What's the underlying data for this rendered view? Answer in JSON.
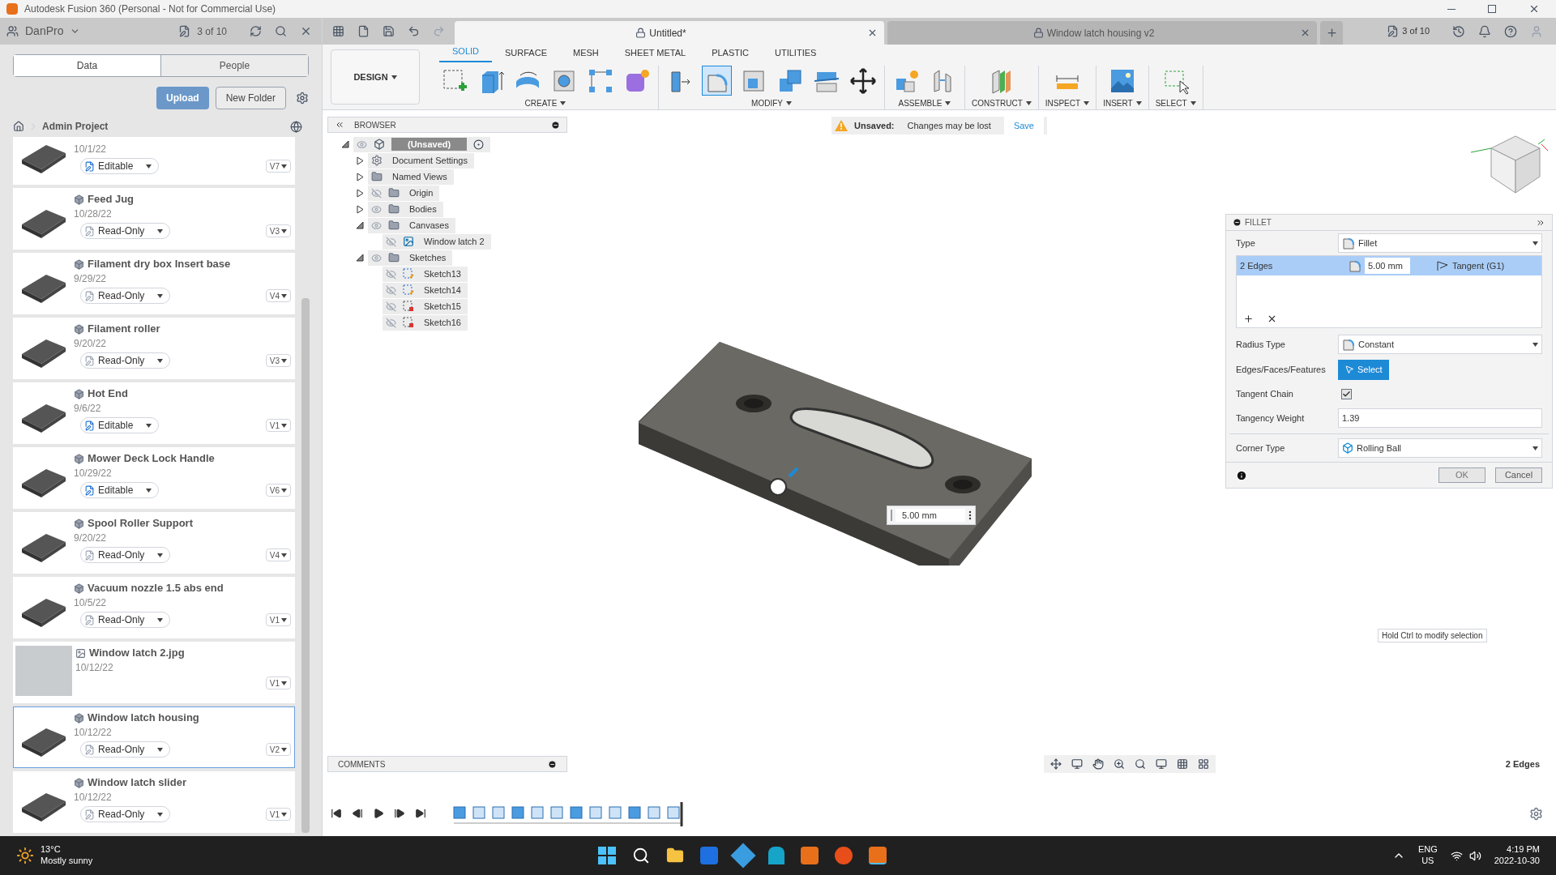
{
  "window": {
    "title": "Autodesk Fusion 360 (Personal - Not for Commercial Use)"
  },
  "data_panel": {
    "team": "DanPro",
    "version_count": "3 of 10",
    "tabs": [
      {
        "label": "Data",
        "selected": true
      },
      {
        "label": "People",
        "selected": false
      }
    ],
    "upload": "Upload",
    "new_folder": "New Folder",
    "breadcrumb": "Admin Project",
    "files": [
      {
        "kind": "design",
        "date": "10/1/22",
        "access": {
          "kind": "editable",
          "label": "Editable"
        },
        "version": "V7",
        "selected": false
      },
      {
        "kind": "design",
        "name": "Feed Jug",
        "date": "10/28/22",
        "access": {
          "kind": "read_only",
          "label": "Read-Only"
        },
        "version": "V3",
        "selected": false
      },
      {
        "kind": "design",
        "name": "Filament dry box Insert base",
        "date": "9/29/22",
        "access": {
          "kind": "read_only",
          "label": "Read-Only"
        },
        "version": "V4",
        "selected": false
      },
      {
        "kind": "design",
        "name": "Filament roller",
        "date": "9/20/22",
        "access": {
          "kind": "read_only",
          "label": "Read-Only"
        },
        "version": "V3",
        "selected": false
      },
      {
        "kind": "design",
        "name": "Hot End",
        "date": "9/6/22",
        "access": {
          "kind": "editable",
          "label": "Editable"
        },
        "version": "V1",
        "selected": false
      },
      {
        "kind": "design",
        "name": "Mower Deck Lock Handle",
        "date": "10/29/22",
        "access": {
          "kind": "editable",
          "label": "Editable"
        },
        "version": "V6",
        "selected": false
      },
      {
        "kind": "design",
        "name": "Spool Roller Support",
        "date": "9/20/22",
        "access": {
          "kind": "read_only",
          "label": "Read-Only"
        },
        "version": "V4",
        "selected": false
      },
      {
        "kind": "design",
        "name": "Vacuum nozzle 1.5 abs end",
        "date": "10/5/22",
        "access": {
          "kind": "read_only",
          "label": "Read-Only"
        },
        "version": "V1",
        "selected": false
      },
      {
        "kind": "image",
        "name": "Window latch 2.jpg",
        "date": "10/12/22",
        "version": "V1",
        "selected": false
      },
      {
        "kind": "design",
        "name": "Window latch housing",
        "date": "10/12/22",
        "access": {
          "kind": "read_only",
          "label": "Read-Only"
        },
        "version": "V2",
        "selected": true
      },
      {
        "kind": "design",
        "name": "Window latch slider",
        "date": "10/12/22",
        "access": {
          "kind": "read_only",
          "label": "Read-Only"
        },
        "version": "V1",
        "selected": false
      }
    ]
  },
  "doc_tabs": [
    {
      "label": "Untitled*",
      "selected": true
    },
    {
      "label": "Window latch housing v2",
      "selected": false
    }
  ],
  "header_right": {
    "version_count": "3 of 10"
  },
  "ribbon": {
    "workspace": "DESIGN",
    "tabs": [
      {
        "label": "SOLID",
        "selected": true
      },
      {
        "label": "SURFACE",
        "selected": false
      },
      {
        "label": "MESH",
        "selected": false
      },
      {
        "label": "SHEET METAL",
        "selected": false
      },
      {
        "label": "PLASTIC",
        "selected": false
      },
      {
        "label": "UTILITIES",
        "selected": false
      }
    ],
    "groups": [
      {
        "label": "CREATE",
        "tools": [
          {
            "kind": "sketch",
            "active": false
          },
          {
            "kind": "extrude",
            "active": false
          },
          {
            "kind": "revolve",
            "active": false
          },
          {
            "kind": "hole",
            "active": false
          },
          {
            "kind": "pattern",
            "active": false
          },
          {
            "kind": "form",
            "active": false
          }
        ]
      },
      {
        "label": "MODIFY",
        "tools": [
          {
            "kind": "press_pull",
            "active": false
          },
          {
            "kind": "fillet",
            "active": true
          },
          {
            "kind": "shell",
            "active": false
          },
          {
            "kind": "combine",
            "active": false
          },
          {
            "kind": "split",
            "active": false
          },
          {
            "kind": "move",
            "active": false
          }
        ]
      },
      {
        "label": "ASSEMBLE",
        "tools": [
          {
            "kind": "component",
            "active": false
          },
          {
            "kind": "joint",
            "active": false
          }
        ]
      },
      {
        "label": "CONSTRUCT",
        "tools": [
          {
            "kind": "plane",
            "active": false
          }
        ]
      },
      {
        "label": "INSPECT",
        "tools": [
          {
            "kind": "measure",
            "active": false
          }
        ]
      },
      {
        "label": "INSERT",
        "tools": [
          {
            "kind": "image",
            "active": false
          }
        ]
      },
      {
        "label": "SELECT",
        "tools": [
          {
            "kind": "select",
            "active": false
          }
        ]
      }
    ]
  },
  "browser": {
    "title": "BROWSER",
    "tree": [
      {
        "label": "(Unsaved)",
        "kind": "root",
        "visible": true,
        "expanded": true,
        "children": [
          {
            "label": "Document Settings",
            "kind": "settings",
            "expanded": false
          },
          {
            "label": "Named Views",
            "kind": "folder",
            "expanded": false
          },
          {
            "label": "Origin",
            "kind": "folder",
            "visible": false,
            "expanded": false
          },
          {
            "label": "Bodies",
            "kind": "folder",
            "visible": true,
            "expanded": false
          },
          {
            "label": "Canvases",
            "kind": "folder",
            "visible": true,
            "expanded": true,
            "children": [
              {
                "label": "Window latch 2",
                "kind": "canvas",
                "visible": false
              }
            ]
          },
          {
            "label": "Sketches",
            "kind": "folder",
            "visible": true,
            "expanded": true,
            "children": [
              {
                "label": "Sketch13",
                "kind": "sketch",
                "visible": false
              },
              {
                "label": "Sketch14",
                "kind": "sketch",
                "visible": false
              },
              {
                "label": "Sketch15",
                "kind": "sketch_locked",
                "visible": false
              },
              {
                "label": "Sketch16",
                "kind": "sketch_locked",
                "visible": false
              }
            ]
          }
        ]
      }
    ]
  },
  "unsaved_banner": {
    "label": "Unsaved:",
    "message": "Changes may be lost",
    "action": "Save"
  },
  "dimension_input": {
    "value": "5.00 mm"
  },
  "fillet": {
    "title": "FILLET",
    "type_label": "Type",
    "type_value": "Fillet",
    "edge_set": {
      "label": "2 Edges",
      "radius": "5.00 mm",
      "continuity": "Tangent (G1)",
      "selected": true
    },
    "radius_type_label": "Radius Type",
    "radius_type_value": "Constant",
    "select_label": "Edges/Faces/Features",
    "select_button": "Select",
    "tangent_chain_label": "Tangent Chain",
    "tangent_chain": true,
    "weight_label": "Tangency Weight",
    "weight_value": "1.39",
    "corner_label": "Corner Type",
    "corner_value": "Rolling Ball",
    "ok": "OK",
    "cancel": "Cancel"
  },
  "tooltip": "Hold Ctrl to modify selection",
  "comments": {
    "title": "COMMENTS"
  },
  "status": "2 Edges",
  "taskbar": {
    "temperature": "13°C",
    "weather": "Mostly sunny",
    "language": "ENG",
    "region": "US",
    "time": "4:19 PM",
    "date": "2022-10-30"
  }
}
